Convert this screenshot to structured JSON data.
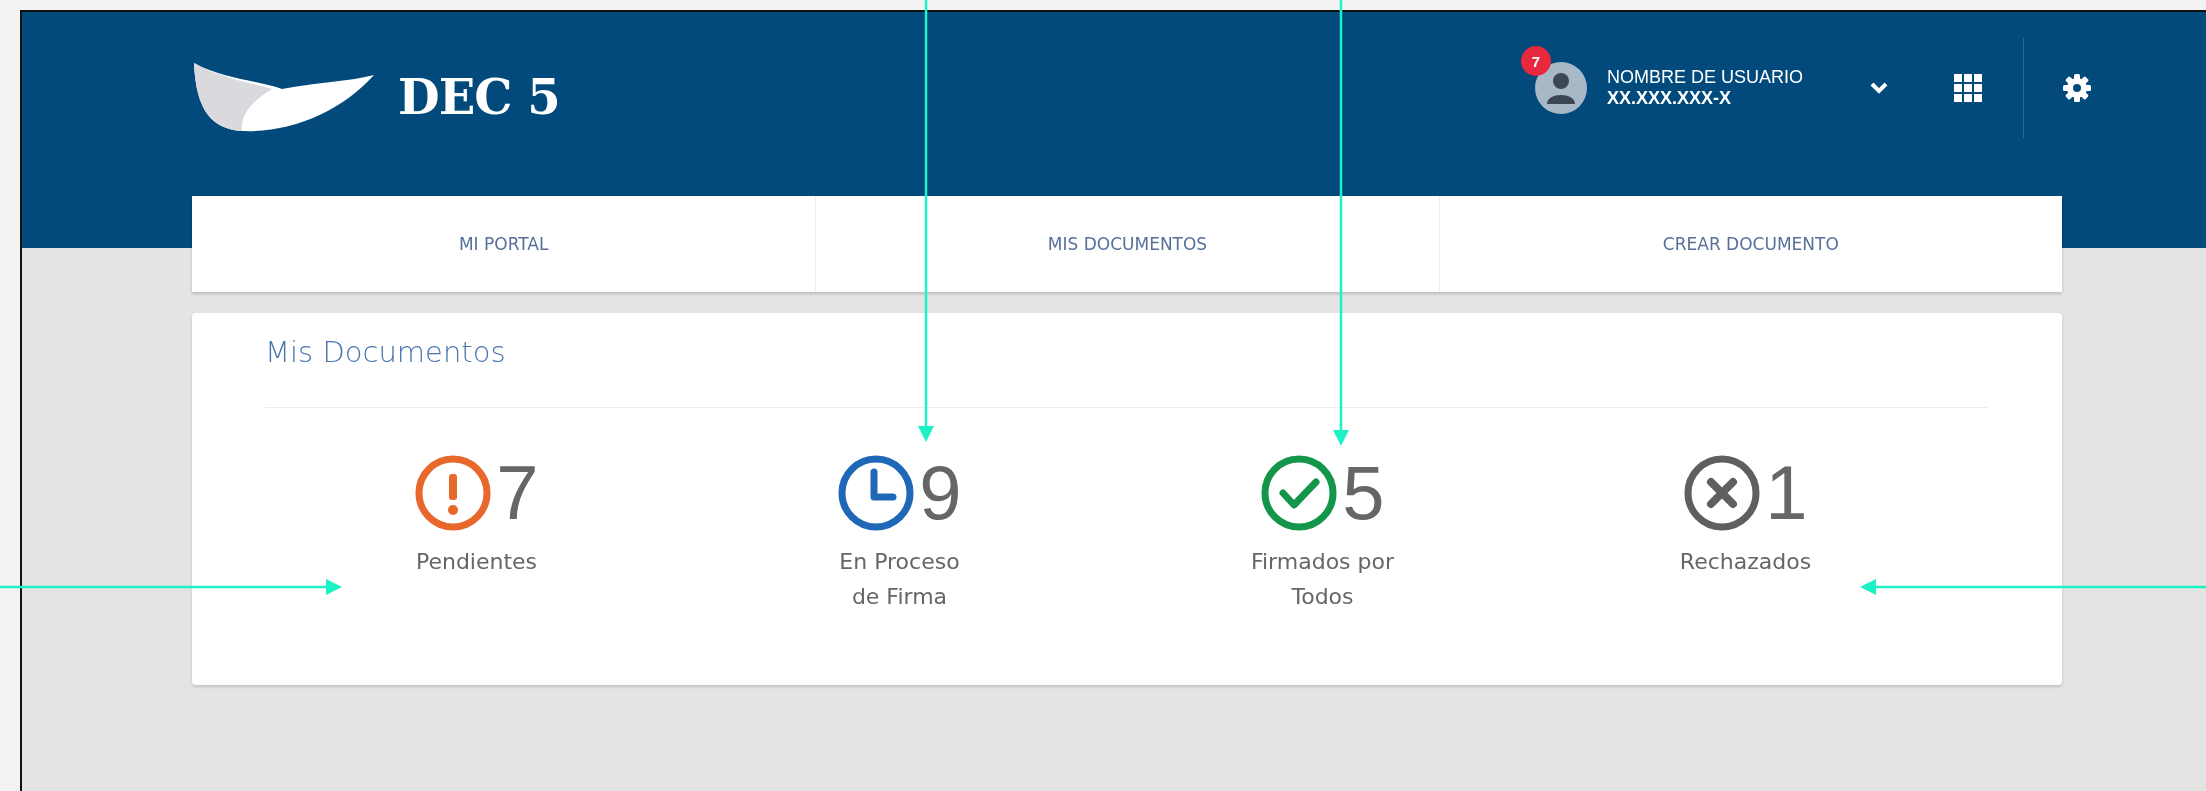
{
  "header": {
    "logo_text": "DEC 5",
    "notification_count": "7",
    "user": {
      "name": "NOMBRE DE USUARIO",
      "id": "XX.XXX.XXX-X"
    }
  },
  "nav": [
    {
      "label": "MI PORTAL"
    },
    {
      "label": "MIS DOCUMENTOS"
    },
    {
      "label": "CREAR DOCUMENTO"
    }
  ],
  "card": {
    "title": "Mis Documentos",
    "stats": [
      {
        "kind": "pending",
        "count": "7",
        "label": "Pendientes"
      },
      {
        "kind": "in_progress",
        "count": "9",
        "label": "En Proceso\nde Firma"
      },
      {
        "kind": "signed",
        "count": "5",
        "label": "Firmados por\nTodos"
      },
      {
        "kind": "rejected",
        "count": "1",
        "label": "Rechazados"
      }
    ]
  }
}
